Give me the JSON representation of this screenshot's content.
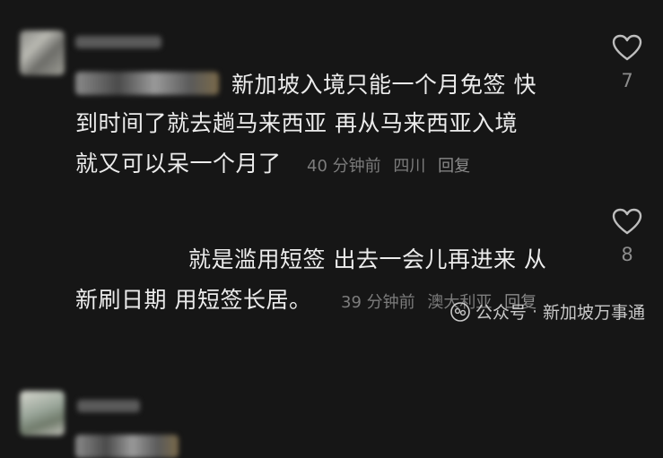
{
  "comments": [
    {
      "lines": [
        "新加坡入境只能一个月免签 快",
        "到时间了就去趟马来西亚 再从马来西亚入境",
        "就又可以呆一个月了"
      ],
      "time": "40 分钟前",
      "location": "四川",
      "reply_label": "回复",
      "like_count": "7"
    },
    {
      "lines": [
        "就是滥用短签 出去一会儿再进来 从",
        "新刷日期 用短签长居。"
      ],
      "time": "39 分钟前",
      "location": "澳大利亚",
      "reply_label": "回复",
      "like_count": "8"
    }
  ],
  "watermark": {
    "label": "公众号",
    "sep": "·",
    "account": "新加坡万事通"
  },
  "colors": {
    "background": "#161616",
    "text": "#ececec",
    "meta": "#7c7c7c"
  },
  "icons": {
    "like": "heart-outline-icon",
    "watermark": "wechat-official-account-icon"
  }
}
